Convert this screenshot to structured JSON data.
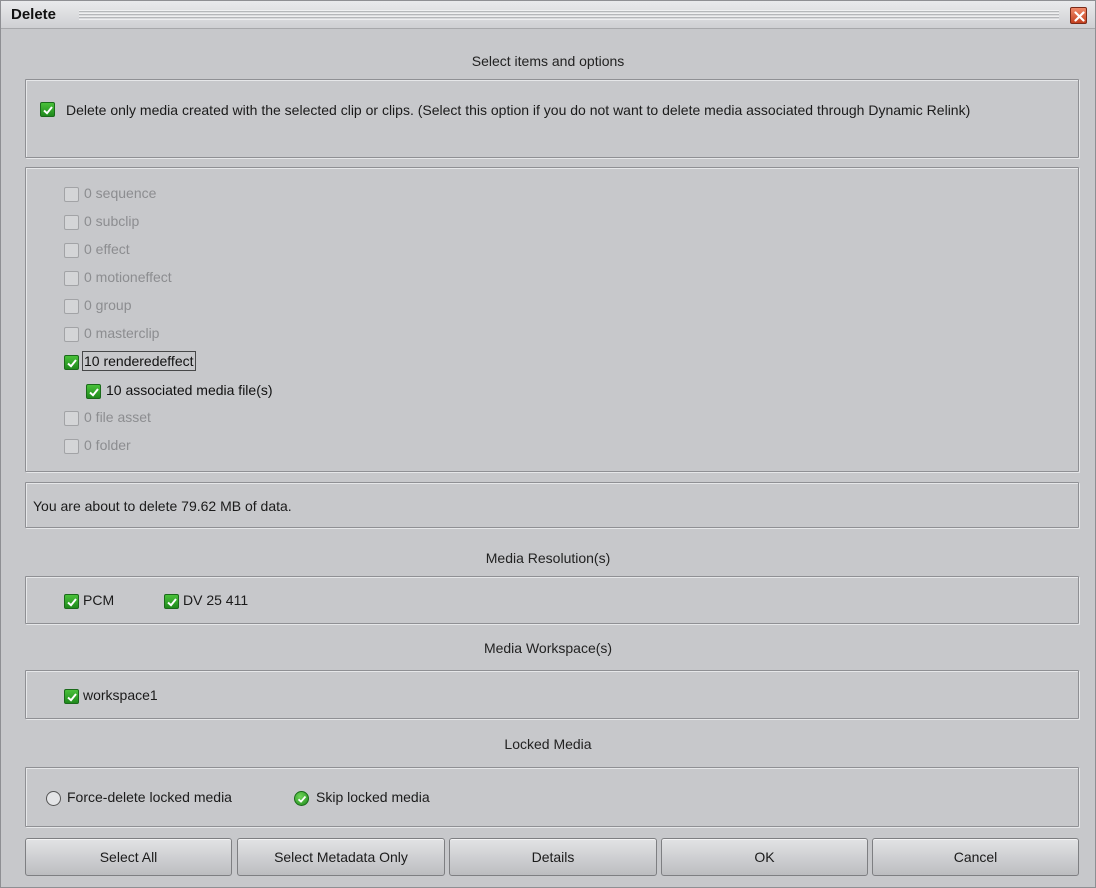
{
  "dialog": {
    "title": "Delete"
  },
  "sections": {
    "select_items": "Select items and options",
    "media_resolution": "Media Resolution(s)",
    "media_workspace": "Media Workspace(s)",
    "locked_media": "Locked Media"
  },
  "option": {
    "text": "Delete only media created with the selected clip or clips. (Select this option if you do not want to delete media associated through Dynamic Relink)",
    "checked": true
  },
  "items": [
    {
      "label": "0 sequence",
      "checked": false,
      "enabled": false
    },
    {
      "label": "0 subclip",
      "checked": false,
      "enabled": false
    },
    {
      "label": "0 effect",
      "checked": false,
      "enabled": false
    },
    {
      "label": "0 motioneffect",
      "checked": false,
      "enabled": false
    },
    {
      "label": "0 group",
      "checked": false,
      "enabled": false
    },
    {
      "label": "0 masterclip",
      "checked": false,
      "enabled": false
    },
    {
      "label": "10 renderedeffect",
      "checked": true,
      "enabled": true
    },
    {
      "label": "10 associated media file(s)",
      "checked": true,
      "enabled": true
    },
    {
      "label": "0 file asset",
      "checked": false,
      "enabled": false
    },
    {
      "label": "0 folder",
      "checked": false,
      "enabled": false
    }
  ],
  "summary": "You are about to delete 79.62 MB of data.",
  "resolutions": [
    {
      "label": "PCM",
      "checked": true
    },
    {
      "label": "DV 25 411",
      "checked": true
    }
  ],
  "workspaces": [
    {
      "label": "workspace1",
      "checked": true
    }
  ],
  "locked": {
    "force_label": "Force-delete locked media",
    "skip_label": "Skip locked media",
    "selected": "skip"
  },
  "buttons": {
    "select_all": "Select All",
    "select_metadata": "Select Metadata Only",
    "details": "Details",
    "ok": "OK",
    "cancel": "Cancel"
  },
  "colors": {
    "check_green": "#2ea52a",
    "dialog_bg": "#c7c8cb"
  }
}
